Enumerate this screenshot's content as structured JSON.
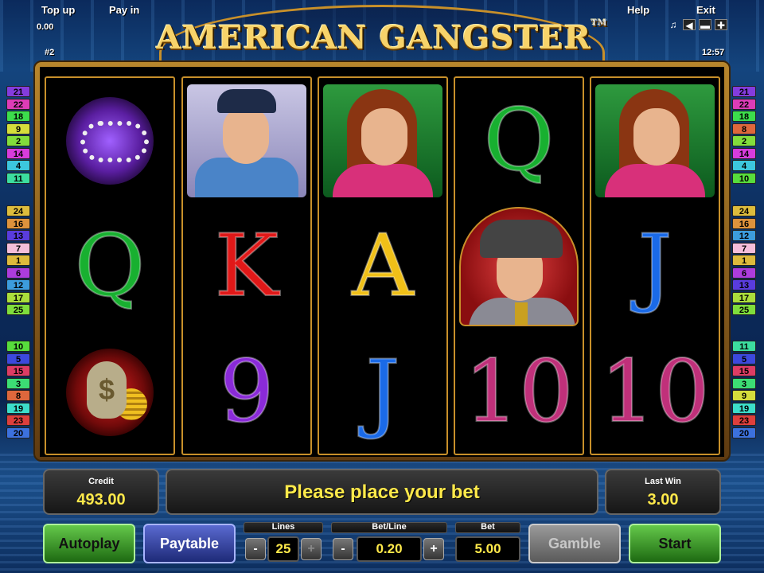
{
  "header": {
    "top_up_label": "Top up",
    "pay_in_label": "Pay in",
    "balance_value": "0.00",
    "game_number": "#2",
    "help_label": "Help",
    "exit_label": "Exit",
    "clock": "12:57",
    "title": "AMERICAN GANGSTER",
    "trademark": "TM"
  },
  "reels": [
    [
      "jewelry",
      "Q",
      "money-bag"
    ],
    [
      "policeman",
      "K",
      "9"
    ],
    [
      "woman",
      "A",
      "J"
    ],
    [
      "Q",
      "gangster",
      "10"
    ],
    [
      "woman",
      "J",
      "10"
    ]
  ],
  "paylines": {
    "left": [
      [
        "21",
        "22",
        "18",
        "9",
        "2",
        "14",
        "4",
        "11"
      ],
      [
        "24",
        "16",
        "13",
        "7",
        "1",
        "6",
        "12",
        "17",
        "25"
      ],
      [
        "10",
        "5",
        "15",
        "3",
        "8",
        "19",
        "23",
        "20"
      ]
    ],
    "right": [
      [
        "21",
        "22",
        "18",
        "8",
        "2",
        "14",
        "4",
        "10"
      ],
      [
        "24",
        "16",
        "12",
        "7",
        "1",
        "6",
        "13",
        "17",
        "25"
      ],
      [
        "11",
        "5",
        "15",
        "3",
        "9",
        "19",
        "23",
        "20"
      ]
    ]
  },
  "colors": {
    "accent_gold": "#c8902a",
    "value_yellow": "#ffe94a",
    "Q": "#18b030",
    "K": "#e01818",
    "A": "#f0c018",
    "J": "#1a6ae8",
    "9": "#8a2ad8",
    "10": "#c0307a"
  },
  "info": {
    "credit_label": "Credit",
    "credit_value": "493.00",
    "message": "Please place your bet",
    "last_win_label": "Last Win",
    "last_win_value": "3.00"
  },
  "controls": {
    "autoplay_label": "Autoplay",
    "paytable_label": "Paytable",
    "lines_label": "Lines",
    "lines_value": "25",
    "bet_line_label": "Bet/Line",
    "bet_line_value": "0.20",
    "bet_label": "Bet",
    "bet_value": "5.00",
    "gamble_label": "Gamble",
    "start_label": "Start",
    "minus": "-",
    "plus": "+"
  }
}
